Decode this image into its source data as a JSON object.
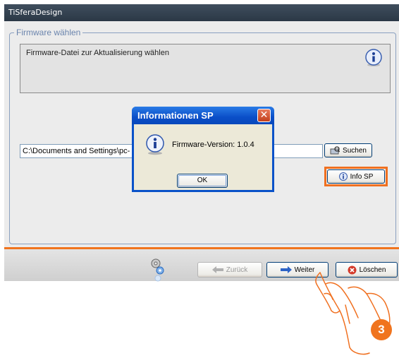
{
  "window": {
    "title": "TiSferaDesign"
  },
  "group": {
    "legend": "Firmware wählen"
  },
  "description": {
    "text": "Firmware-Datei zur Aktualisierung wählen",
    "icon": "info-icon"
  },
  "file": {
    "path": "C:\\Documents and Settings\\pc-                                                                _010004.fi"
  },
  "buttons": {
    "search": "Suchen",
    "info_sp": "Info SP"
  },
  "dialog": {
    "title": "Informationen SP",
    "close_glyph": "✕",
    "message": "Firmware-Version: 1.0.4",
    "ok": "OK"
  },
  "footer": {
    "back": "Zurück",
    "next": "Weiter",
    "delete": "Löschen"
  },
  "annotation": {
    "step": "3"
  },
  "colors": {
    "accent": "#f0741e",
    "dialog_blue": "#0a52c9"
  }
}
